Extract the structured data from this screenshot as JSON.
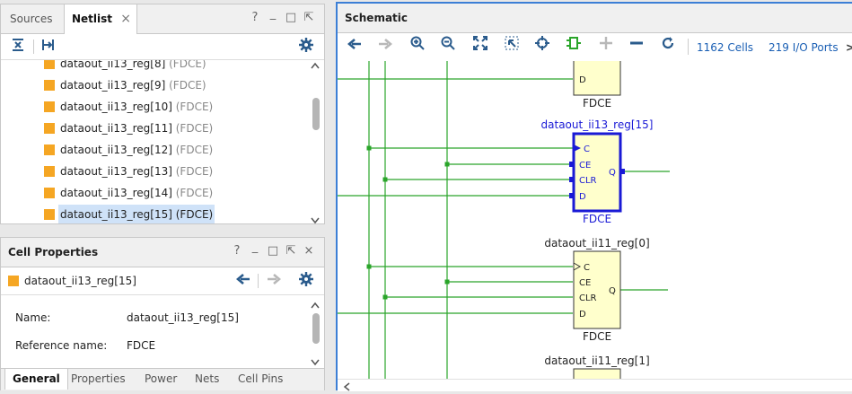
{
  "netlist_panel": {
    "tabs": [
      {
        "label": "Sources"
      },
      {
        "label": "Netlist"
      }
    ],
    "close_glyph": "×",
    "window_controls": [
      "?",
      "_",
      "□",
      "⇱"
    ],
    "toolbar": [
      "collapse-all-icon",
      "expand-all-icon",
      "gear-icon"
    ],
    "rows": [
      {
        "name": "dataout_ii13_reg[8]",
        "type": "(FDCE)"
      },
      {
        "name": "dataout_ii13_reg[9]",
        "type": "(FDCE)"
      },
      {
        "name": "dataout_ii13_reg[10]",
        "type": "(FDCE)"
      },
      {
        "name": "dataout_ii13_reg[11]",
        "type": "(FDCE)"
      },
      {
        "name": "dataout_ii13_reg[12]",
        "type": "(FDCE)"
      },
      {
        "name": "dataout_ii13_reg[13]",
        "type": "(FDCE)"
      },
      {
        "name": "dataout_ii13_reg[14]",
        "type": "(FDCE)"
      },
      {
        "name": "dataout_ii13_reg[15]",
        "type": "(FDCE)"
      }
    ]
  },
  "cell_properties": {
    "title": "Cell Properties",
    "window_controls": [
      "?",
      "_",
      "□",
      "⇱",
      "×"
    ],
    "selected_cell": "dataout_ii13_reg[15]",
    "fields": [
      {
        "label": "Name:",
        "value": "dataout_ii13_reg[15]"
      },
      {
        "label": "Reference name:",
        "value": "FDCE"
      }
    ],
    "bottom_tabs": [
      {
        "label": "General"
      },
      {
        "label": "Properties"
      },
      {
        "label": "Power"
      },
      {
        "label": "Nets"
      },
      {
        "label": "Cell Pins"
      }
    ]
  },
  "schematic": {
    "title": "Schematic",
    "cells_count": "1162 Cells",
    "io_ports": "219 I/O Ports",
    "more": ">",
    "cells": [
      {
        "name": "",
        "type": "FDCE",
        "pins": [
          "D"
        ],
        "out": ""
      },
      {
        "name": "dataout_ii13_reg[15]",
        "type": "FDCE",
        "pins": [
          "C",
          "CE",
          "CLR",
          "D"
        ],
        "out": "Q"
      },
      {
        "name": "dataout_ii11_reg[0]",
        "type": "FDCE",
        "pins": [
          "C",
          "CE",
          "CLR",
          "D"
        ],
        "out": "Q"
      },
      {
        "name": "dataout_ii11_reg[1]",
        "type": "",
        "pins": [],
        "out": ""
      }
    ]
  },
  "colors": {
    "wire": "#2aa52a",
    "cell_fill": "#ffffcc",
    "selected": "#1a1ad6",
    "accent": "#1a5fb4",
    "tree_square": "#f5a623"
  }
}
